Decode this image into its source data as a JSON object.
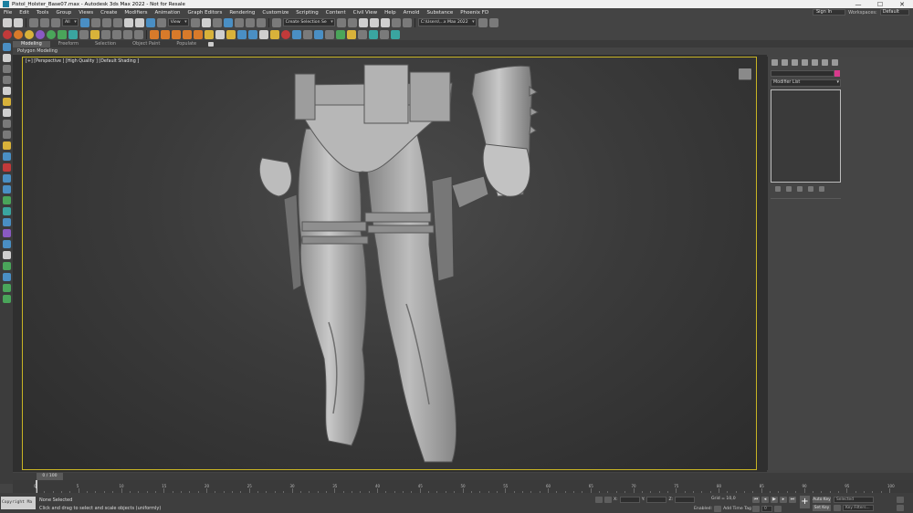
{
  "window": {
    "title": "Pistol_Holster_Base07.max - Autodesk 3ds Max 2022 - Not for Resale",
    "minimize": "—",
    "maximize": "☐",
    "close": "✕"
  },
  "menu": [
    "File",
    "Edit",
    "Tools",
    "Group",
    "Views",
    "Create",
    "Modifiers",
    "Animation",
    "Graph Editors",
    "Rendering",
    "Customize",
    "Scripting",
    "Content",
    "Civil View",
    "Help",
    "Arnold",
    "Substance",
    "Phoenix FD"
  ],
  "account": {
    "signin": "Sign In",
    "workspaces_label": "Workspaces:",
    "workspace": "Default"
  },
  "toolbar": {
    "filter_all": "All",
    "ref_coord": "View",
    "selection_set": "Create Selection Se",
    "project_path": "C:\\Users\\...x Max 2022"
  },
  "ribbon": {
    "tabs": [
      "Modeling",
      "Freeform",
      "Selection",
      "Object Paint",
      "Populate"
    ],
    "active_tab": "Modeling",
    "sub_label": "Polygon Modeling"
  },
  "viewport": {
    "label": "[+] [Perspective ] [High Quality ] [Default Shading ]"
  },
  "command_panel": {
    "modifier_list": "Modifier List",
    "object_color": "#d83a8c"
  },
  "timeline": {
    "frame_display": "0 / 100",
    "ticks": [
      "0",
      "5",
      "10",
      "15",
      "20",
      "25",
      "30",
      "35",
      "40",
      "45",
      "50",
      "55",
      "60",
      "65",
      "70",
      "75",
      "80",
      "85",
      "90",
      "95",
      "100"
    ]
  },
  "status": {
    "copyright": "Copyright Ma",
    "selection": "None Selected",
    "prompt": "Click and drag to select and scale objects (uniformly)",
    "x_label": "X:",
    "y_label": "Y:",
    "z_label": "Z:",
    "grid": "Grid = 10,0",
    "enabled": "Enabled:",
    "add_time_tag": "Add Time Tag",
    "auto_key": "Auto Key",
    "set_key": "Set Key",
    "selected": "Selected",
    "key_filters": "Key Filters...",
    "frame": "0"
  }
}
